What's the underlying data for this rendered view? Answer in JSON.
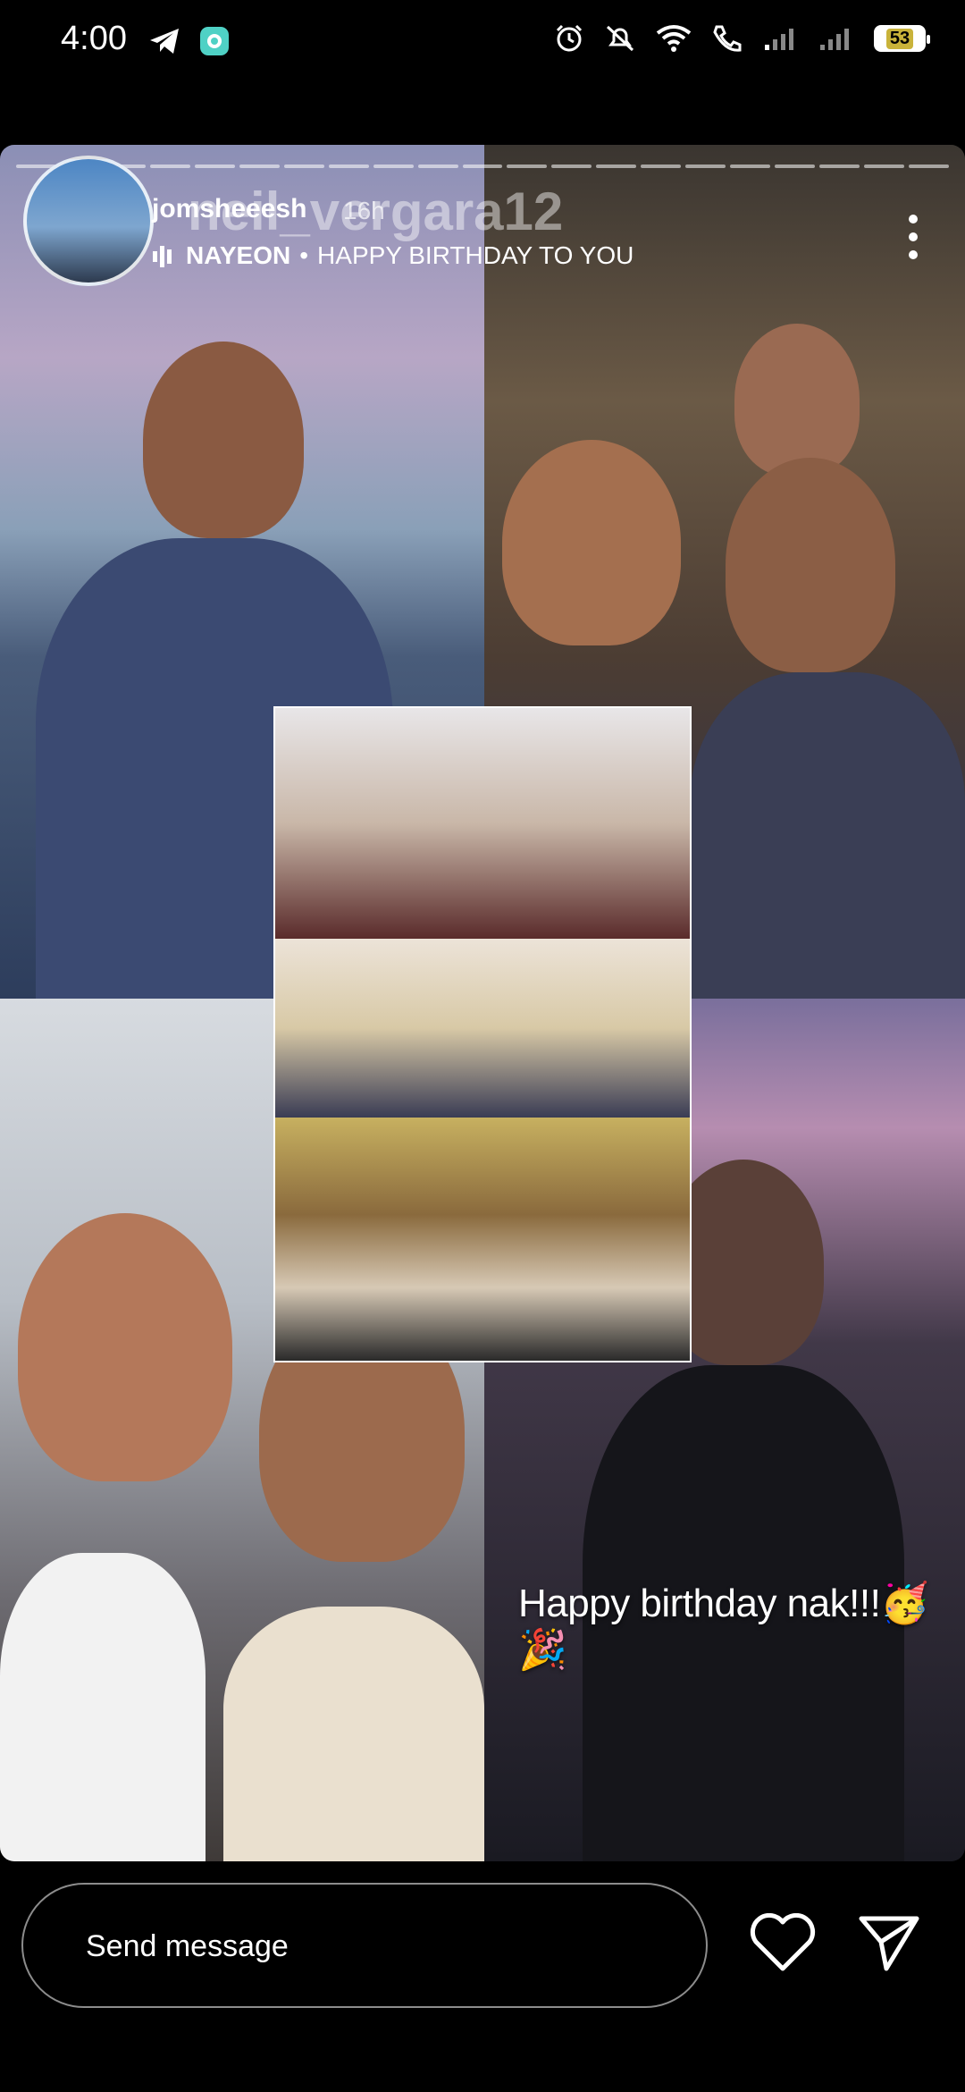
{
  "status_bar": {
    "time": "4:00",
    "battery": "53",
    "icons": [
      "telegram-icon",
      "app-icon",
      "alarm-icon",
      "mute-icon",
      "wifi-icon",
      "call-icon",
      "signal-icon",
      "signal-icon"
    ]
  },
  "story": {
    "username": "jomsheeesh",
    "time_ago": "16h",
    "background_username": "neil_vergara12",
    "music_artist": "NAYEON",
    "music_separator": "•",
    "music_title": "HAPPY BIRTHDAY TO YOU",
    "caption": "Happy birthday nak!!!🥳🎉",
    "progress_segments": 21
  },
  "composer": {
    "placeholder": "Send message",
    "like_icon": "heart-icon",
    "send_icon": "send-icon"
  },
  "colors": {
    "background": "#000000",
    "text": "#ffffff"
  }
}
